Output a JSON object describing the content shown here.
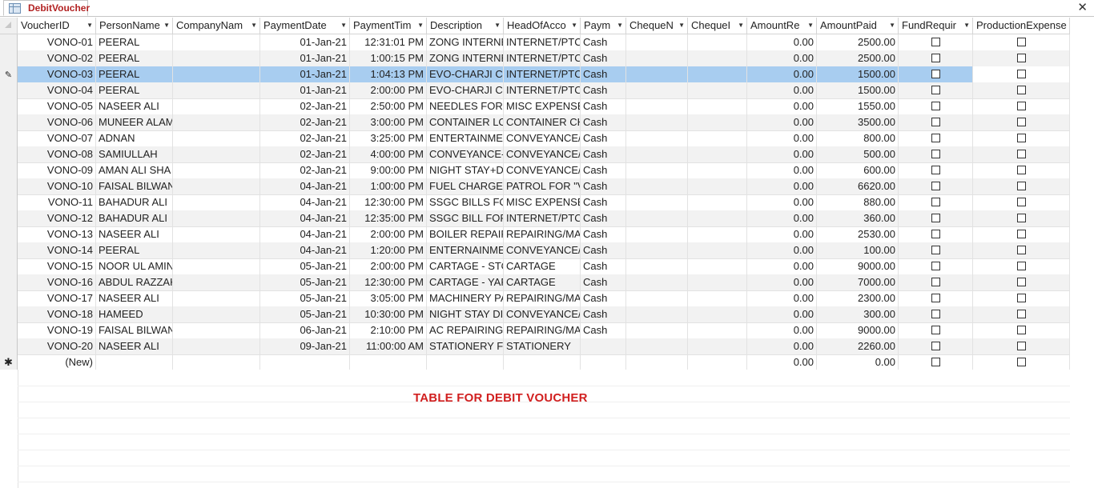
{
  "tab": {
    "title": "DebitVoucher",
    "close_glyph": "✕"
  },
  "columns": [
    "VoucherID",
    "PersonName",
    "CompanyNam",
    "PaymentDate",
    "PaymentTim",
    "Description",
    "HeadOfAcco",
    "Paym",
    "ChequeN",
    "ChequeI",
    "AmountRe",
    "AmountPaid",
    "FundRequir",
    "ProductionExpense"
  ],
  "rows": [
    {
      "id": "VONO-01",
      "person": "PEERAL",
      "company": "",
      "date": "01-Jan-21",
      "time": "12:31:01 PM",
      "desc": "ZONG INTERNE",
      "head": "INTERNET/PTCI",
      "pay": "Cash",
      "chqn": "",
      "chqd": "",
      "amtrec": "0.00",
      "amtpaid": "2500.00"
    },
    {
      "id": "VONO-02",
      "person": "PEERAL",
      "company": "",
      "date": "01-Jan-21",
      "time": "1:00:15 PM",
      "desc": "ZONG INTERNE",
      "head": "INTERNET/PTCI",
      "pay": "Cash",
      "chqn": "",
      "chqd": "",
      "amtrec": "0.00",
      "amtpaid": "2500.00"
    },
    {
      "id": "VONO-03",
      "person": "PEERAL",
      "company": "",
      "date": "01-Jan-21",
      "time": "1:04:13 PM",
      "desc": "EVO-CHARJI CL",
      "head": "INTERNET/PTCI",
      "pay": "Cash",
      "chqn": "",
      "chqd": "",
      "amtrec": "0.00",
      "amtpaid": "1500.00"
    },
    {
      "id": "VONO-04",
      "person": "PEERAL",
      "company": "",
      "date": "01-Jan-21",
      "time": "2:00:00 PM",
      "desc": "EVO-CHARJI CL",
      "head": "INTERNET/PTCI",
      "pay": "Cash",
      "chqn": "",
      "chqd": "",
      "amtrec": "0.00",
      "amtpaid": "1500.00"
    },
    {
      "id": "VONO-05",
      "person": "NASEER ALI",
      "company": "",
      "date": "02-Jan-21",
      "time": "2:50:00 PM",
      "desc": "NEEDLES FOR S",
      "head": "MISC EXPENSES",
      "pay": "Cash",
      "chqn": "",
      "chqd": "",
      "amtrec": "0.00",
      "amtpaid": "1550.00"
    },
    {
      "id": "VONO-06",
      "person": "MUNEER ALAM",
      "company": "",
      "date": "02-Jan-21",
      "time": "3:00:00 PM",
      "desc": "CONTAINER LO",
      "head": "CONTAINER CH",
      "pay": "Cash",
      "chqn": "",
      "chqd": "",
      "amtrec": "0.00",
      "amtpaid": "3500.00"
    },
    {
      "id": "VONO-07",
      "person": "ADNAN",
      "company": "",
      "date": "02-Jan-21",
      "time": "3:25:00 PM",
      "desc": "ENTERTAINMEI",
      "head": "CONVEYANCE/",
      "pay": "Cash",
      "chqn": "",
      "chqd": "",
      "amtrec": "0.00",
      "amtpaid": "800.00"
    },
    {
      "id": "VONO-08",
      "person": "SAMIULLAH",
      "company": "",
      "date": "02-Jan-21",
      "time": "4:00:00 PM",
      "desc": "CONVEYANCE-",
      "head": "CONVEYANCE/",
      "pay": "Cash",
      "chqn": "",
      "chqd": "",
      "amtrec": "0.00",
      "amtpaid": "500.00"
    },
    {
      "id": "VONO-09",
      "person": "AMAN ALI SHA",
      "company": "",
      "date": "02-Jan-21",
      "time": "9:00:00 PM",
      "desc": "NIGHT STAY+DI",
      "head": "CONVEYANCE/",
      "pay": "Cash",
      "chqn": "",
      "chqd": "",
      "amtrec": "0.00",
      "amtpaid": "600.00"
    },
    {
      "id": "VONO-10",
      "person": "FAISAL BILWAN",
      "company": "",
      "date": "04-Jan-21",
      "time": "1:00:00 PM",
      "desc": "FUEL CHARGES",
      "head": "PATROL FOR \"V",
      "pay": "Cash",
      "chqn": "",
      "chqd": "",
      "amtrec": "0.00",
      "amtpaid": "6620.00"
    },
    {
      "id": "VONO-11",
      "person": "BAHADUR ALI",
      "company": "",
      "date": "04-Jan-21",
      "time": "12:30:00 PM",
      "desc": "SSGC BILLS FOR",
      "head": "MISC EXPENSES",
      "pay": "Cash",
      "chqn": "",
      "chqd": "",
      "amtrec": "0.00",
      "amtpaid": "880.00"
    },
    {
      "id": "VONO-12",
      "person": "BAHADUR ALI",
      "company": "",
      "date": "04-Jan-21",
      "time": "12:35:00 PM",
      "desc": "SSGC BILL FOR I",
      "head": "INTERNET/PTCI",
      "pay": "Cash",
      "chqn": "",
      "chqd": "",
      "amtrec": "0.00",
      "amtpaid": "360.00"
    },
    {
      "id": "VONO-13",
      "person": "NASEER ALI",
      "company": "",
      "date": "04-Jan-21",
      "time": "2:00:00 PM",
      "desc": "BOILER REPAIR",
      "head": "REPAIRING/MA",
      "pay": "Cash",
      "chqn": "",
      "chqd": "",
      "amtrec": "0.00",
      "amtpaid": "2530.00"
    },
    {
      "id": "VONO-14",
      "person": "PEERAL",
      "company": "",
      "date": "04-Jan-21",
      "time": "1:20:00 PM",
      "desc": "ENTERNAINME",
      "head": "CONVEYANCE/",
      "pay": "Cash",
      "chqn": "",
      "chqd": "",
      "amtrec": "0.00",
      "amtpaid": "100.00"
    },
    {
      "id": "VONO-15",
      "person": "NOOR UL AMIN",
      "company": "",
      "date": "05-Jan-21",
      "time": "2:00:00 PM",
      "desc": "CARTAGE - STO",
      "head": "CARTAGE",
      "pay": "Cash",
      "chqn": "",
      "chqd": "",
      "amtrec": "0.00",
      "amtpaid": "9000.00"
    },
    {
      "id": "VONO-16",
      "person": "ABDUL RAZZAK",
      "company": "",
      "date": "05-Jan-21",
      "time": "12:30:00 PM",
      "desc": "CARTAGE - YAR",
      "head": "CARTAGE",
      "pay": "Cash",
      "chqn": "",
      "chqd": "",
      "amtrec": "0.00",
      "amtpaid": "7000.00"
    },
    {
      "id": "VONO-17",
      "person": "NASEER ALI",
      "company": "",
      "date": "05-Jan-21",
      "time": "3:05:00 PM",
      "desc": "MACHINERY PA",
      "head": "REPAIRING/MA",
      "pay": "Cash",
      "chqn": "",
      "chqd": "",
      "amtrec": "0.00",
      "amtpaid": "2300.00"
    },
    {
      "id": "VONO-18",
      "person": "HAMEED",
      "company": "",
      "date": "05-Jan-21",
      "time": "10:30:00 PM",
      "desc": "NIGHT STAY DII",
      "head": "CONVEYANCE/",
      "pay": "Cash",
      "chqn": "",
      "chqd": "",
      "amtrec": "0.00",
      "amtpaid": "300.00"
    },
    {
      "id": "VONO-19",
      "person": "FAISAL BILWAN",
      "company": "",
      "date": "06-Jan-21",
      "time": "2:10:00 PM",
      "desc": "AC REPAIRING",
      "head": "REPAIRING/MA",
      "pay": "Cash",
      "chqn": "",
      "chqd": "",
      "amtrec": "0.00",
      "amtpaid": "9000.00"
    },
    {
      "id": "VONO-20",
      "person": "NASEER ALI",
      "company": "",
      "date": "09-Jan-21",
      "time": "11:00:00 AM",
      "desc": "STATIONERY FO",
      "head": "STATIONERY",
      "pay": "",
      "chqn": "",
      "chqd": "",
      "amtrec": "0.00",
      "amtpaid": "2260.00"
    }
  ],
  "new_row": {
    "label": "(New)",
    "amtrec": "0.00",
    "amtpaid": "0.00"
  },
  "selected_row_index": 2,
  "caption": "TABLE FOR DEBIT VOUCHER",
  "icons": {
    "record_edit": "pencil-icon",
    "new_record": "star-icon",
    "table": "table-icon"
  }
}
